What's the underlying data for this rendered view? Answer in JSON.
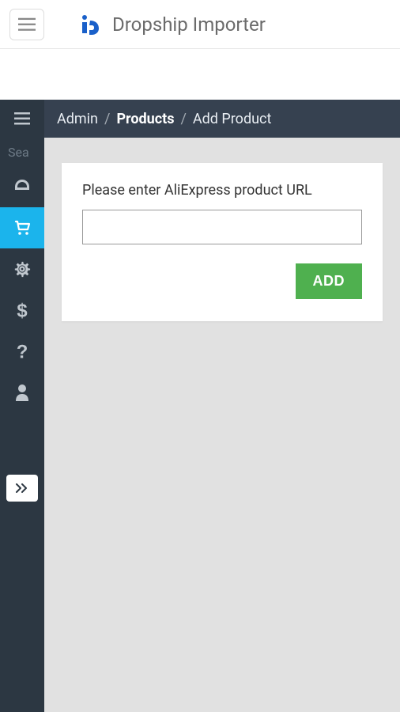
{
  "header": {
    "app_title": "Dropship Importer"
  },
  "sidebar": {
    "search_placeholder": "Sea"
  },
  "breadcrumb": {
    "item1": "Admin",
    "item2": "Products",
    "item3": "Add Product",
    "sep": "/"
  },
  "card": {
    "label": "Please enter AliExpress product URL",
    "input_value": "",
    "add_button": "ADD"
  },
  "colors": {
    "sidebar_bg": "#2c3742",
    "sidebar_active": "#1bb4ec",
    "breadcrumb_bg": "#364150",
    "content_bg": "#e1e1e1",
    "add_btn_bg": "#4fb04f"
  }
}
